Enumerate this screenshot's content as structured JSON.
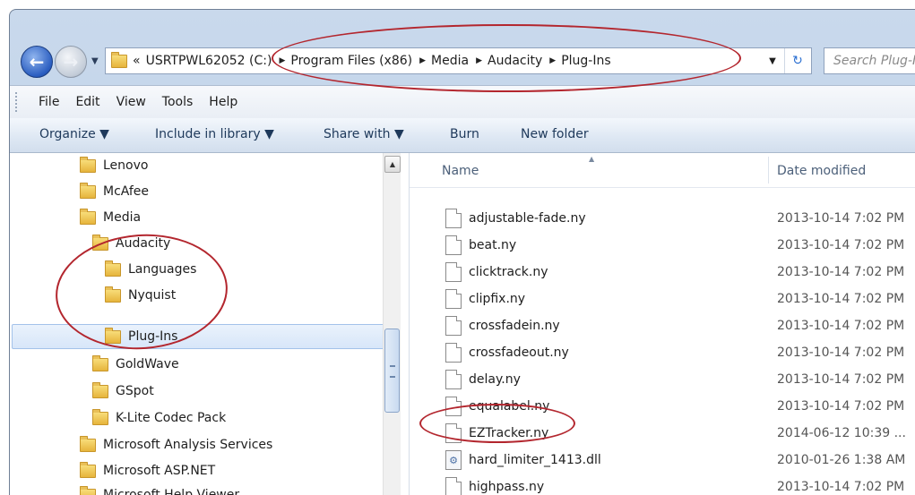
{
  "address": {
    "overflow": "«",
    "crumbs": [
      "USRTPWL62052 (C:)",
      "Program Files (x86)",
      "Media",
      "Audacity",
      "Plug-Ins"
    ],
    "search_placeholder": "Search Plug-Ins"
  },
  "menu": [
    "File",
    "Edit",
    "View",
    "Tools",
    "Help"
  ],
  "commands": {
    "organize": "Organize ▼",
    "include": "Include in library ▼",
    "share": "Share with ▼",
    "burn": "Burn",
    "newfolder": "New folder"
  },
  "tree": [
    {
      "label": "Lenovo",
      "level": 0
    },
    {
      "label": "McAfee",
      "level": 0
    },
    {
      "label": "Media",
      "level": 0
    },
    {
      "label": "Audacity",
      "level": 1
    },
    {
      "label": "Languages",
      "level": 2
    },
    {
      "label": "Nyquist",
      "level": 2
    },
    {
      "label": "Plug-Ins",
      "level": 2,
      "selected": true
    },
    {
      "label": "GoldWave",
      "level": 1
    },
    {
      "label": "GSpot",
      "level": 1
    },
    {
      "label": "K-Lite Codec Pack",
      "level": 1
    },
    {
      "label": "Microsoft Analysis Services",
      "level": 0
    },
    {
      "label": "Microsoft ASP.NET",
      "level": 0
    },
    {
      "label": "Microsoft Help Viewer",
      "level": 0
    }
  ],
  "columns": {
    "name": "Name",
    "date": "Date modified"
  },
  "files": [
    {
      "name": "adjustable-fade.ny",
      "date": "2013-10-14 7:02 PM",
      "type": "doc"
    },
    {
      "name": "beat.ny",
      "date": "2013-10-14 7:02 PM",
      "type": "doc"
    },
    {
      "name": "clicktrack.ny",
      "date": "2013-10-14 7:02 PM",
      "type": "doc"
    },
    {
      "name": "clipfix.ny",
      "date": "2013-10-14 7:02 PM",
      "type": "doc"
    },
    {
      "name": "crossfadein.ny",
      "date": "2013-10-14 7:02 PM",
      "type": "doc"
    },
    {
      "name": "crossfadeout.ny",
      "date": "2013-10-14 7:02 PM",
      "type": "doc"
    },
    {
      "name": "delay.ny",
      "date": "2013-10-14 7:02 PM",
      "type": "doc"
    },
    {
      "name": "equalabel.ny",
      "date": "2013-10-14 7:02 PM",
      "type": "doc"
    },
    {
      "name": "EZTracker.ny",
      "date": "2014-06-12 10:39 ...",
      "type": "doc"
    },
    {
      "name": "hard_limiter_1413.dll",
      "date": "2010-01-26 1:38 AM",
      "type": "dll"
    },
    {
      "name": "highpass.ny",
      "date": "2013-10-14 7:02 PM",
      "type": "doc"
    }
  ],
  "colors": {
    "annotation": "#b3262e",
    "selection": "#d7e6f9"
  }
}
